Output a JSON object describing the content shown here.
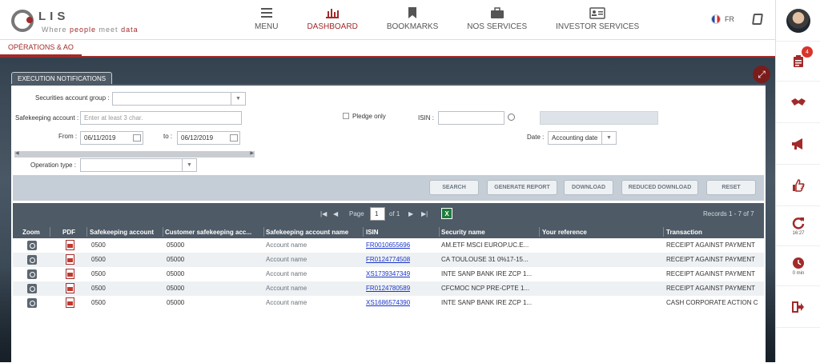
{
  "brand": {
    "logo_letters": "LIS",
    "tagline_pre": "Where ",
    "tagline_people": "people",
    "tagline_meet": " meet ",
    "tagline_data": "data"
  },
  "nav": [
    {
      "label": "MENU",
      "icon": "menu-icon"
    },
    {
      "label": "DASHBOARD",
      "icon": "chart-icon",
      "active": true
    },
    {
      "label": "BOOKMARKS",
      "icon": "bookmark-icon"
    },
    {
      "label": "NOS SERVICES",
      "icon": "briefcase-icon"
    },
    {
      "label": "INVESTOR SERVICES",
      "icon": "id-card-icon"
    }
  ],
  "language": "FR",
  "subnav": {
    "label": "OPÉRATIONS & AO"
  },
  "panel": {
    "title": "EXECUTION NOTIFICATIONS"
  },
  "filters": {
    "securities_account_group_label": "Securities account group :",
    "safekeeping_account_label": "Safekeeping account :",
    "safekeeping_account_placeholder": "Enter at least 3 char.",
    "from_label": "From :",
    "from_value": "06/11/2019",
    "to_label": "to :",
    "to_value": "06/12/2019",
    "pledge_only_label": "Pledge only",
    "isin_label": "ISIN :",
    "date_label": "Date :",
    "date_value": "Accounting date",
    "operation_type_label": "Operation type :"
  },
  "buttons": {
    "search": "SEARCH",
    "generate_report": "GENERATE REPORT",
    "download": "DOWNLOAD",
    "reduced_download": "REDUCED DOWNLOAD",
    "reset": "RESET"
  },
  "pager": {
    "page_label": "Page",
    "page_value": "1",
    "of_label": "of 1",
    "records": "Records 1 - 7 of 7"
  },
  "columns": [
    "Zoom",
    "PDF",
    "Safekeeping account",
    "Customer safekeeping acc...",
    "Safekeeping account name",
    "ISIN",
    "Security name",
    "Your reference",
    "Transaction"
  ],
  "rows": [
    {
      "safekeeping": "0500",
      "customer": "05000",
      "name": "Account name",
      "isin": "FR0010655696",
      "security": "AM.ETF MSCI EUROP.UC.E...",
      "reference": "",
      "transaction": "RECEIPT AGAINST PAYMENT"
    },
    {
      "safekeeping": "0500",
      "customer": "05000",
      "name": "Account name",
      "isin": "FR0124774508",
      "security": "CA TOULOUSE 31 0%17-15...",
      "reference": "",
      "transaction": "RECEIPT AGAINST PAYMENT"
    },
    {
      "safekeeping": "0500",
      "customer": "05000",
      "name": "Account name",
      "isin": "XS1739347349",
      "security": "INTE SANP BANK IRE ZCP 1...",
      "reference": "",
      "transaction": "RECEIPT AGAINST PAYMENT"
    },
    {
      "safekeeping": "0500",
      "customer": "05000",
      "name": "Account name",
      "isin": "FR0124780589",
      "security": "CFCMOC NCP PRE-CPTE 1...",
      "reference": "",
      "transaction": "RECEIPT AGAINST PAYMENT"
    },
    {
      "safekeeping": "0500",
      "customer": "05000",
      "name": "Account name",
      "isin": "XS1686574390",
      "security": "INTE SANP BANK IRE ZCP 1...",
      "reference": "",
      "transaction": "CASH CORPORATE ACTION C"
    }
  ],
  "rail": {
    "notification_count": "4",
    "refresh_time": "16:27",
    "timer": "0 min"
  },
  "colors": {
    "brand": "#a12a2a",
    "header": "#4e5a66",
    "link": "#1a35c8"
  }
}
